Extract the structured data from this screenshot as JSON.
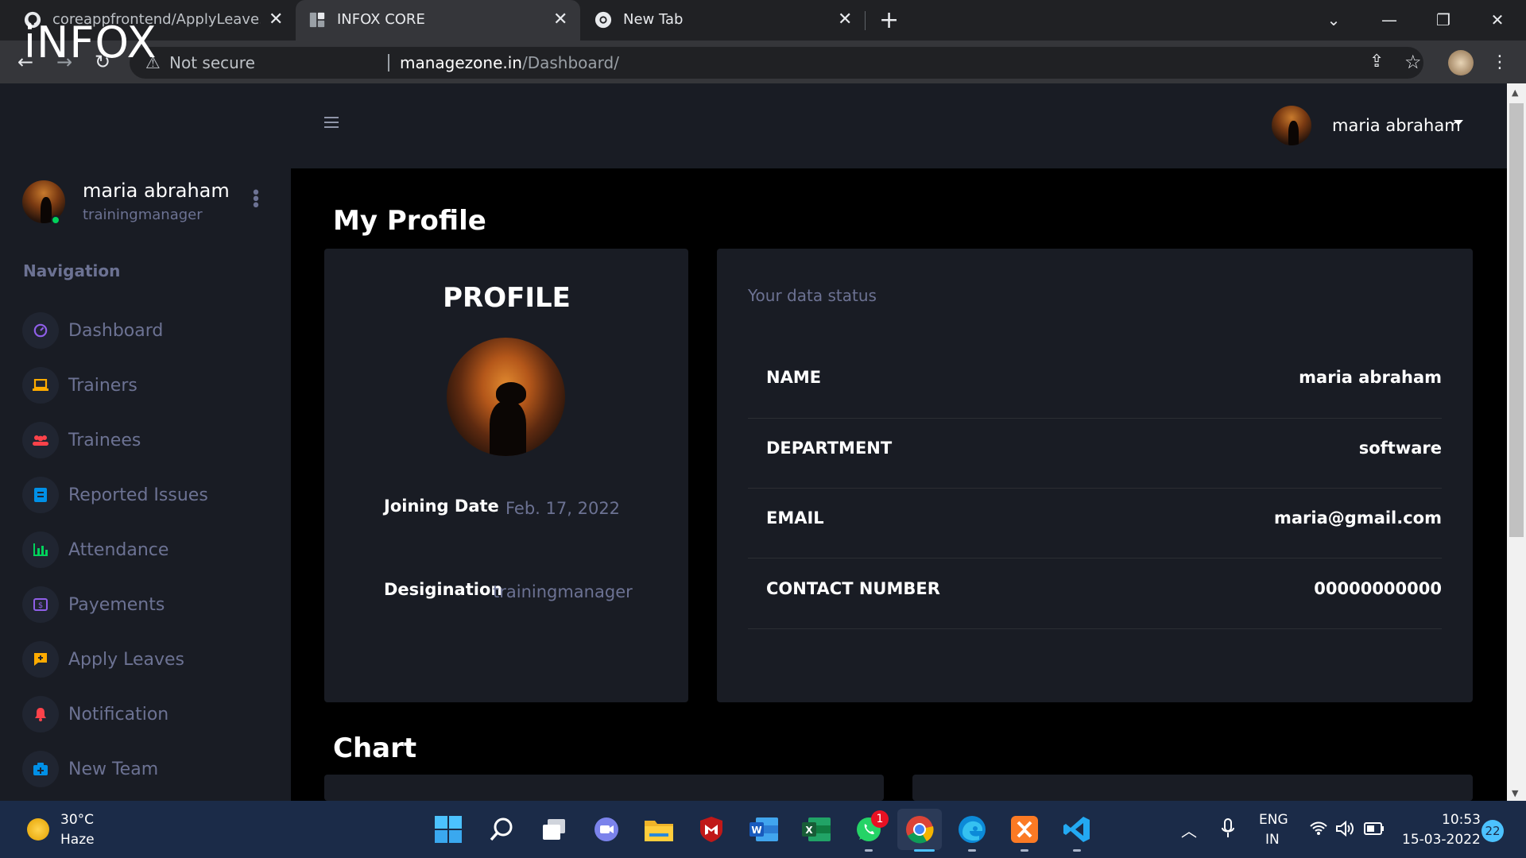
{
  "browser": {
    "tabs": [
      {
        "title": "coreappfrontend/ApplyLeave.htm",
        "icon": "github-icon",
        "active": false
      },
      {
        "title": "INFOX CORE",
        "icon": "page-icon",
        "active": true
      },
      {
        "title": "New Tab",
        "icon": "chrome-icon",
        "active": false
      }
    ],
    "security_label": "Not secure",
    "url_domain": "managezone.in",
    "url_path": "/Dashboard/"
  },
  "app": {
    "brand": "iNFOX",
    "user": {
      "name": "maria abraham",
      "role": "trainingmanager"
    },
    "nav_heading": "Navigation",
    "nav": [
      {
        "label": "Dashboard",
        "icon": "speedometer-icon",
        "color": "#8f5fe8"
      },
      {
        "label": "Trainers",
        "icon": "laptop-icon",
        "color": "#ffab00"
      },
      {
        "label": "Trainees",
        "icon": "people-icon",
        "color": "#fc424a"
      },
      {
        "label": "Reported Issues",
        "icon": "document-icon",
        "color": "#0090e7"
      },
      {
        "label": "Attendance",
        "icon": "chart-icon",
        "color": "#00d25b"
      },
      {
        "label": "Payements",
        "icon": "payment-icon",
        "color": "#8f5fe8"
      },
      {
        "label": "Apply Leaves",
        "icon": "leave-icon",
        "color": "#ffab00"
      },
      {
        "label": "Notification",
        "icon": "bell-icon",
        "color": "#fc424a"
      },
      {
        "label": "New Team",
        "icon": "team-icon",
        "color": "#0090e7"
      }
    ],
    "topbar_user": "maria abraham"
  },
  "main": {
    "title": "My Profile",
    "profile_card": {
      "title": "PROFILE",
      "joining_label": "Joining Date",
      "joining_value": "Feb. 17, 2022",
      "designation_label": "Desigination",
      "designation_value": "trainingmanager"
    },
    "status_card": {
      "heading": "Your data status",
      "rows": [
        {
          "label": "NAME",
          "value": "maria abraham"
        },
        {
          "label": "DEPARTMENT",
          "value": "software"
        },
        {
          "label": "EMAIL",
          "value": "maria@gmail.com"
        },
        {
          "label": "CONTACT NUMBER",
          "value": "00000000000"
        }
      ]
    },
    "chart_title": "Chart"
  },
  "taskbar": {
    "weather_temp": "30°C",
    "weather_desc": "Haze",
    "lang_top": "ENG",
    "lang_bottom": "IN",
    "time": "10:53",
    "date": "15-03-2022",
    "notification_count": "22",
    "whatsapp_badge": "1"
  }
}
